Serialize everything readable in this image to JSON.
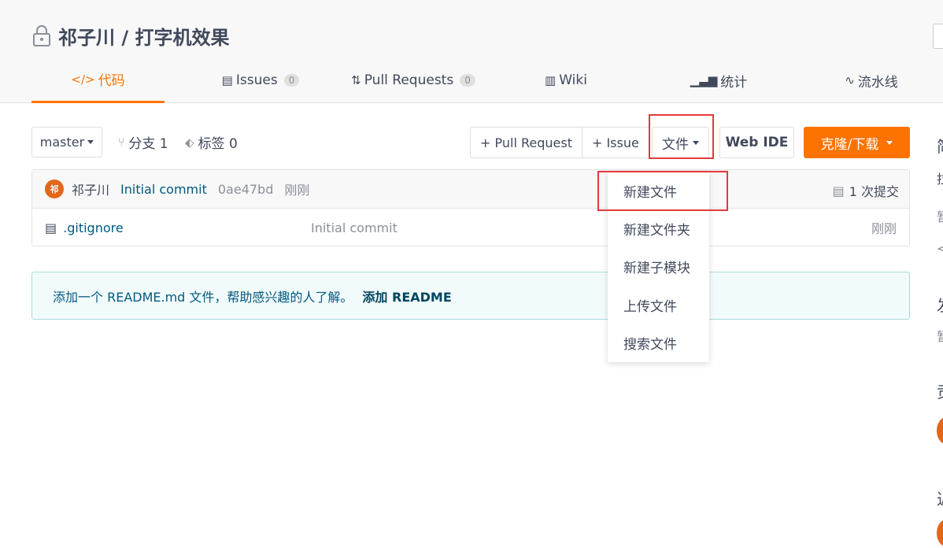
{
  "repo": {
    "title": "祁子川 / 打字机效果",
    "icon": "lock-icon"
  },
  "tabs": [
    {
      "label": "代码",
      "icon": "code-icon",
      "active": true
    },
    {
      "label": "Issues",
      "icon": "issues-icon",
      "badge": "0"
    },
    {
      "label": "Pull Requests",
      "icon": "pull-request-icon",
      "badge": "0"
    },
    {
      "label": "Wiki",
      "icon": "wiki-icon"
    },
    {
      "label": "统计",
      "icon": "stats-icon"
    },
    {
      "label": "流水线",
      "icon": "pipeline-icon"
    }
  ],
  "toolbar": {
    "branch": "master",
    "branches_label": "分支 1",
    "tags_label": "标签 0",
    "pull_request_btn": "+ Pull Request",
    "issue_btn": "+ Issue",
    "file_btn": "文件",
    "webide_btn": "Web IDE",
    "clone_btn": "克隆/下载"
  },
  "commit": {
    "avatar_text": "祁",
    "author": "祁子川",
    "message": "Initial commit",
    "hash": "0ae47bd",
    "time": "刚刚",
    "count": "1 次提交"
  },
  "files": [
    {
      "name": ".gitignore",
      "commit_msg": "Initial commit",
      "time": "刚刚"
    }
  ],
  "readme_notice": {
    "text": "添加一个 README.md 文件，帮助感兴趣的人了解。",
    "link": "添加 README"
  },
  "file_menu": [
    "新建文件",
    "新建文件夹",
    "新建子模块",
    "上传文件",
    "搜索文件"
  ],
  "colors": {
    "accent": "#fe7300",
    "link": "#005980",
    "highlight": "#e4393c"
  }
}
